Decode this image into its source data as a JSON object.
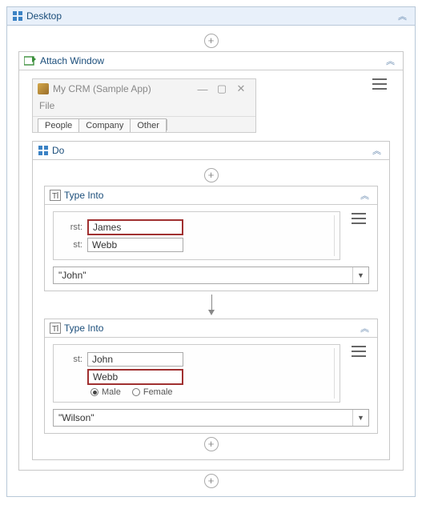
{
  "desktop": {
    "title": "Desktop"
  },
  "attach": {
    "title": "Attach Window",
    "window": {
      "title": "My CRM (Sample App)",
      "menu": "File",
      "tabs": [
        "People",
        "Company",
        "Other"
      ]
    }
  },
  "doSeq": {
    "title": "Do"
  },
  "typeInto1": {
    "title": "Type Into",
    "fields": {
      "row1": {
        "label": "rst:",
        "value": "James",
        "highlight": true
      },
      "row2": {
        "label": "st:",
        "value": "Webb",
        "highlight": false
      }
    },
    "textValue": "\"John\""
  },
  "typeInto2": {
    "title": "Type Into",
    "fields": {
      "row1": {
        "label": "st:",
        "value": "John",
        "highlight": false
      },
      "row2": {
        "label": "",
        "value": "Webb",
        "highlight": true
      }
    },
    "radios": {
      "opt1": "Male",
      "opt2": "Female"
    },
    "textValue": "\"Wilson\""
  }
}
